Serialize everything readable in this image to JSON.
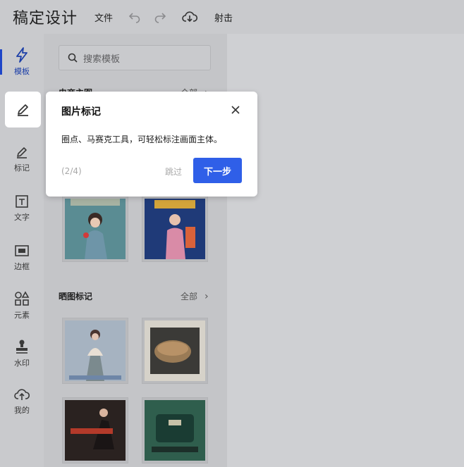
{
  "app": {
    "title": "稿定设计"
  },
  "topbar": {
    "menu_file": "文件",
    "menu_shoot": "射击"
  },
  "rail": {
    "items": [
      {
        "label": "模板",
        "icon": "lightning-icon"
      },
      {
        "label": "",
        "icon": "pen-icon"
      },
      {
        "label": "标记",
        "icon": "pen-icon"
      },
      {
        "label": "文字",
        "icon": "text-icon"
      },
      {
        "label": "边框",
        "icon": "frame-icon"
      },
      {
        "label": "元素",
        "icon": "shapes-icon"
      },
      {
        "label": "水印",
        "icon": "stamp-icon"
      },
      {
        "label": "我的",
        "icon": "cloud-upload-icon"
      }
    ]
  },
  "panel": {
    "search": {
      "placeholder": "搜索模板"
    },
    "sections": [
      {
        "title": "电商主图",
        "more": "全部"
      },
      {
        "title": "晒图标记",
        "more": "全部"
      }
    ]
  },
  "popup": {
    "title": "图片标记",
    "description": "圈点、马赛克工具，可轻松标注画面主体。",
    "step": "(2/4)",
    "skip": "跳过",
    "next": "下一步"
  },
  "colors": {
    "accent": "#2f5fe8",
    "active_rail": "#1f46c8"
  }
}
